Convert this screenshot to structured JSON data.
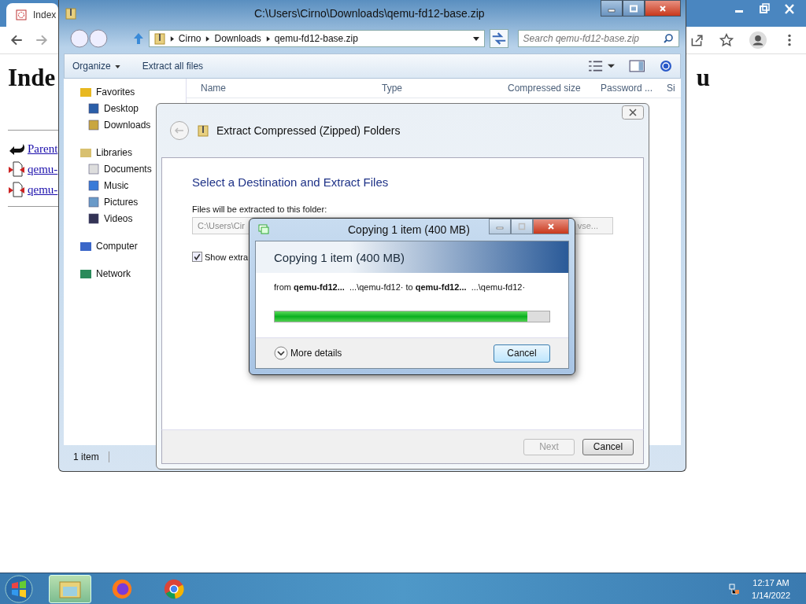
{
  "browser": {
    "tab_title": "Index",
    "heading_start": "Inde",
    "heading_end": "u",
    "links": [
      {
        "kind": "parent",
        "label": "Parent"
      },
      {
        "kind": "file",
        "label": "qemu-"
      },
      {
        "kind": "file",
        "label": "qemu-"
      }
    ]
  },
  "explorer": {
    "title": "C:\\Users\\Cirno\\Downloads\\qemu-fd12-base.zip",
    "breadcrumb": [
      "Cirno",
      "Downloads",
      "qemu-fd12-base.zip"
    ],
    "search": {
      "placeholder": "Search qemu-fd12-base.zip"
    },
    "toolbar": [
      "Organize",
      "Extract all files"
    ],
    "columns": [
      "Name",
      "Type",
      "Compressed size",
      "Password ...",
      "Si"
    ],
    "nav": [
      {
        "label": "Favorites",
        "kind": "favorites",
        "children": [
          {
            "label": "Desktop",
            "kind": "desktop"
          },
          {
            "label": "Downloads",
            "kind": "downloads"
          }
        ]
      },
      {
        "label": "Libraries",
        "kind": "libraries",
        "children": [
          {
            "label": "Documents",
            "kind": "documents"
          },
          {
            "label": "Music",
            "kind": "music"
          },
          {
            "label": "Pictures",
            "kind": "pictures"
          },
          {
            "label": "Videos",
            "kind": "videos"
          }
        ]
      },
      {
        "label": "Computer",
        "kind": "computer"
      },
      {
        "label": "Network",
        "kind": "network"
      }
    ],
    "status": "1 item"
  },
  "wizard": {
    "title": "Extract Compressed (Zipped) Folders",
    "heading": "Select a Destination and Extract Files",
    "folder_label": "Files will be extracted to this folder:",
    "folder_value": "C:\\Users\\Cir",
    "browse": "vse...",
    "show_files": {
      "label": "Show extra",
      "checked": true
    },
    "buttons": [
      {
        "label": "Next",
        "disabled": true
      },
      {
        "label": "Cancel",
        "disabled": false
      }
    ]
  },
  "copy_dialog": {
    "title": "Copying 1 item (400 MB)",
    "heading": "Copying 1 item (400 MB)",
    "detail": "from **qemu-fd12...**  ...\\qemu-fd12· to **qemu-fd12...**  ...\\qemu-fd12·",
    "level": 0.92,
    "more_details": "More details",
    "cancel": "Cancel"
  },
  "taskbar": {
    "apps": [
      {
        "kind": "explorer",
        "selected": true
      },
      {
        "kind": "firefox",
        "selected": false
      },
      {
        "kind": "chrome",
        "selected": false
      }
    ],
    "time": "12:17 AM",
    "date": "1/14/2022"
  }
}
